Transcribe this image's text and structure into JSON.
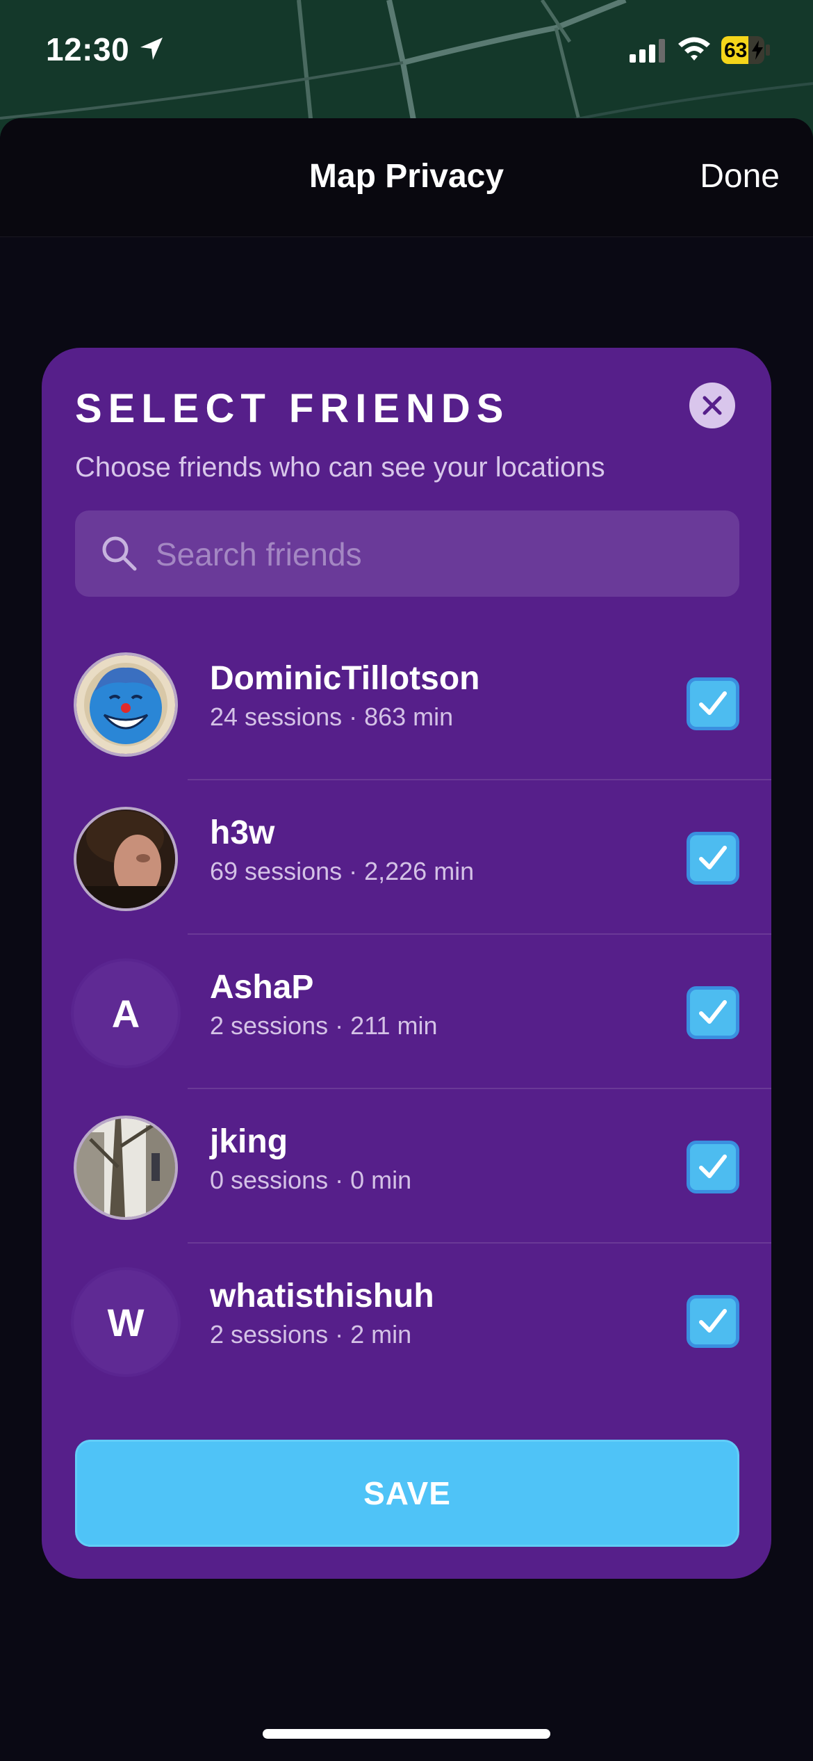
{
  "status_bar": {
    "time": "12:30",
    "battery": "63",
    "battery_level": 0.63
  },
  "nav": {
    "title": "Map Privacy",
    "done_label": "Done"
  },
  "modal": {
    "title": "SELECT FRIENDS",
    "subtitle": "Choose friends who can see your locations",
    "search_placeholder": "Search friends",
    "save_label": "SAVE"
  },
  "friends": [
    {
      "name": "DominicTillotson",
      "stats": "24 sessions · 863 min",
      "avatar": "photo-cartoon",
      "checked": true
    },
    {
      "name": "h3w",
      "stats": "69 sessions · 2,226 min",
      "avatar": "photo-person",
      "checked": true
    },
    {
      "name": "AshaP",
      "stats": "2 sessions · 211 min",
      "avatar_letter": "A",
      "checked": true
    },
    {
      "name": "jking",
      "stats": "0 sessions · 0 min",
      "avatar": "photo-tree",
      "checked": true
    },
    {
      "name": "whatisthishuh",
      "stats": "2 sessions · 2 min",
      "avatar_letter": "W",
      "checked": true
    }
  ],
  "colors": {
    "modal_bg": "#561f8a",
    "accent": "#4fc3f7"
  }
}
